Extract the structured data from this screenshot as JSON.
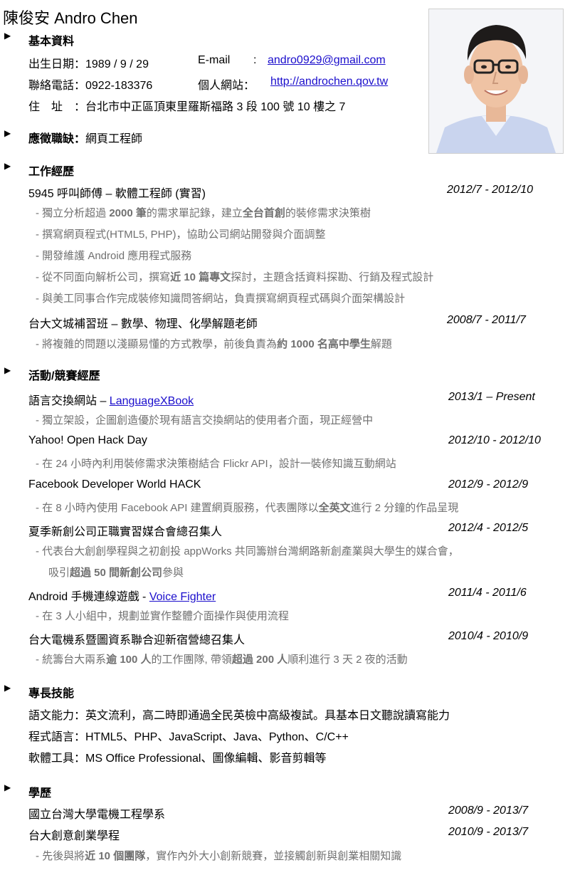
{
  "name": "陳俊安  Andro Chen",
  "sections": {
    "basic": "基本資料",
    "position": "應徵職缺：",
    "work": "工作經歷",
    "activities": "活動/競賽經歷",
    "skills": "專長技能",
    "education": "學歷"
  },
  "bullet": "▶",
  "basic": {
    "birth": "出生日期：1989 / 9 / 29",
    "email_label": "E-mail",
    "email_colon": ":",
    "email": "andro0929@gmail.com",
    "phone": "聯絡電話：0922-183376",
    "site_label": "個人網站：",
    "site": "http://androchen.qov.tw",
    "address": "住　址　：台北市中正區頂東里羅斯福路 3 段 100 號 10 樓之 7"
  },
  "position_value": "網頁工程師",
  "work": {
    "job1": {
      "title": "5945  呼叫師傅  –  軟體工程師  (實習)",
      "date": "2012/7 - 2012/10"
    },
    "job1_items": [
      [
        "-  獨立分析超過 ",
        "2000 筆",
        "的需求單記錄，建立",
        "全台首創",
        "的裝修需求決策樹"
      ],
      [
        "-  撰寫網頁程式(HTML5, PHP)，協助公司網站開發與介面調整"
      ],
      [
        "-  開發維護 Android  應用程式服務"
      ],
      [
        "-  從不同面向解析公司，撰寫",
        "近 10 篇專文",
        "探討，主題含括資料探勘、行銷及程式設計"
      ],
      [
        "-  與美工同事合作完成裝修知識問答網站，負責撰寫網頁程式碼與介面架構設計"
      ]
    ],
    "job2": {
      "title": "台大文城補習班  –  數學、物理、化學解題老師",
      "date": "2008/7 - 2011/7"
    },
    "job2_items": [
      [
        "-  將複雜的問題以淺顯易懂的方式教學，前後負責為",
        "約 1000 名高中學生",
        "解題"
      ]
    ]
  },
  "activities": {
    "a1": {
      "title": "語言交換網站  – ",
      "link": "LanguageXBook",
      "date": "2013/1 – Present"
    },
    "a1_item": "-  獨立架設，企圖創造優於現有語言交換網站的使用者介面，現正經營中",
    "a2": {
      "title": "Yahoo! Open Hack Day",
      "date": "2012/10 - 2012/10"
    },
    "a2_item": "-  在 24 小時內利用裝修需求決策樹結合 Flickr API，設計一裝修知識互動網站",
    "a3": {
      "title": "Facebook Developer World HACK",
      "date": "2012/9 - 2012/9"
    },
    "a3_item": [
      "-  在 8 小時內使用  Facebook API  建置網頁服務，代表團隊以",
      "全英文",
      "進行 2 分鐘的作品呈現"
    ],
    "a4": {
      "title": "夏季新創公司正職實習媒合會總召集人",
      "date": "2012/4 - 2012/5"
    },
    "a4_item1": "-  代表台大創創學程與之初創投  appWorks 共同籌辦台灣網路新創產業與大學生的媒合會，",
    "a4_item2": [
      "吸引",
      "超過 50 間新創公司",
      "參與"
    ],
    "a5": {
      "title": "Android  手機連線遊戲  - ",
      "link": "Voice Fighter",
      "date": "2011/4 - 2011/6"
    },
    "a5_item": "-  在 3 人小組中，規劃並實作整體介面操作與使用流程",
    "a6": {
      "title": "台大電機系暨圖資系聯合迎新宿營總召集人",
      "date": "2010/4 - 2010/9"
    },
    "a6_item": [
      "-  統籌台大兩系",
      "逾 100 人",
      "的工作團隊, 帶領",
      "超過 200 人",
      "順利進行 3 天 2 夜的活動"
    ]
  },
  "skills": [
    "語文能力：英文流利，高二時即通過全民英檢中高級複試。具基本日文聽說讀寫能力",
    "程式語言：HTML5、PHP、JavaScript、Java、Python、C/C++",
    "軟體工具：MS Office Professional、圖像編輯、影音剪輯等"
  ],
  "education": {
    "e1": {
      "title": "國立台灣大學電機工程學系",
      "date": "2008/9 - 2013/7"
    },
    "e2": {
      "title": "台大創意創業學程",
      "date": "2010/9 - 2013/7"
    },
    "e2_item": [
      "-  先後與將",
      "近 10 個團隊",
      "，實作內外大小創新競賽，並接觸創新與創業相關知識"
    ]
  },
  "colors": {
    "link": "#1a0dcc",
    "muted": "#707070",
    "text": "#000000"
  },
  "photo_icon": "profile-photo"
}
